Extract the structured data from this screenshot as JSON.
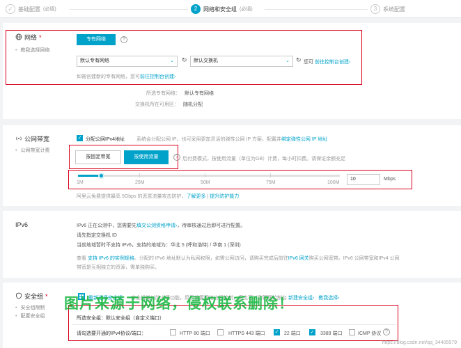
{
  "steps": [
    {
      "label": "基础配置",
      "sub": "(必填)",
      "num": "✓"
    },
    {
      "label": "网络和安全组",
      "sub": "(必填)",
      "num": "2"
    },
    {
      "label": "系统配置",
      "sub": "",
      "num": "3"
    }
  ],
  "network": {
    "title": "网络",
    "required": "*",
    "sub": "教我选择网络",
    "tab": "专有网络",
    "vpc_select": "默认专有网络",
    "vswitch_select": "默认交换机",
    "or_text": "您可",
    "console_link": "前往控制台创建›",
    "hint_text": "如需创建新的专有网络，您可",
    "hint_link": "前往控制台创建›",
    "selected_vpc_label": "所选专有网络：",
    "selected_vpc_value": "默认专有网络",
    "zone_label": "交换机所在可用区：",
    "zone_value": "随机分配"
  },
  "bandwidth": {
    "title": "公网带宽",
    "sub": "公网带宽计费",
    "assign_label": "分配公网IPv4地址",
    "assign_desc": "系统会分配公网 IP，也可采用更加灵活的弹性公网 IP 方案，配置并",
    "assign_link": "绑定弹性公网 IP 地址",
    "fixed_btn": "按固定带宽",
    "traffic_btn": "按使用流量",
    "traffic_desc": "后付费模式，按使用流量（单位为GB）计费，每小时扣费。请保证余额充足",
    "ticks": [
      "1M",
      "25M",
      "50M",
      "75M",
      "100M"
    ],
    "value": "10",
    "unit": "Mbps",
    "level": 0.09,
    "ddos_text": "阿里云免费提供最高 5Gbps 的恶意流量攻击防护，",
    "ddos_link1": "了解更多",
    "ddos_sep": " | ",
    "ddos_link2": "提升防护能力"
  },
  "ipv6": {
    "title": "IPv6",
    "line1_a": "IPv6 正在公测中，您需要先",
    "line1_link": "填交公测资格申请›",
    "line1_b": "，待审核通过后即可进行配置。",
    "line2": "请先指定交换机 ID",
    "line3": "当前地域暂时不支持 IPv6，支持的地域为：华北 5 (呼和浩特) / 华南 1 (深圳)",
    "line4_a": "查看",
    "line4_link": "支持 IPv6 的实例规格",
    "line4_b": "。分配的 IPv6 地址默认为私网权限，如需公网访问，请购买完成后前往",
    "line4_link2": "IPv6 网关",
    "line4_c": "购买公网宽带。IPv6 公网带宽和IPv4 公网",
    "line5": "带宽是互相独立的资源，需单独购买。"
  },
  "security": {
    "title": "安全组",
    "required": "*",
    "sub1": "安全组限制",
    "sub2": "配置安全组",
    "reselect": "重新选择安全组",
    "desc": "安全组类似防火墙功能，用于设置网络访问控制，您也可以到管理控制台",
    "desc_link": "新建安全组›",
    "teach_link": "教我选择›",
    "selected_label": "所选安全组：",
    "selected_value": "默认安全组（自定义端口）",
    "ports_label": "请勾选要开通的IPv4协议/端口：",
    "ports": [
      {
        "label": "HTTP 80 端口",
        "checked": false
      },
      {
        "label": "HTTPS 443 端口",
        "checked": false
      },
      {
        "label": "22 端口",
        "checked": true
      },
      {
        "label": "3389 端口",
        "checked": true
      },
      {
        "label": "ICMP 协议",
        "checked": false
      }
    ]
  },
  "watermark": "图片来源于网络，侵权联系删除！",
  "credit": "https://blog.csdn.net/qq_34405579"
}
